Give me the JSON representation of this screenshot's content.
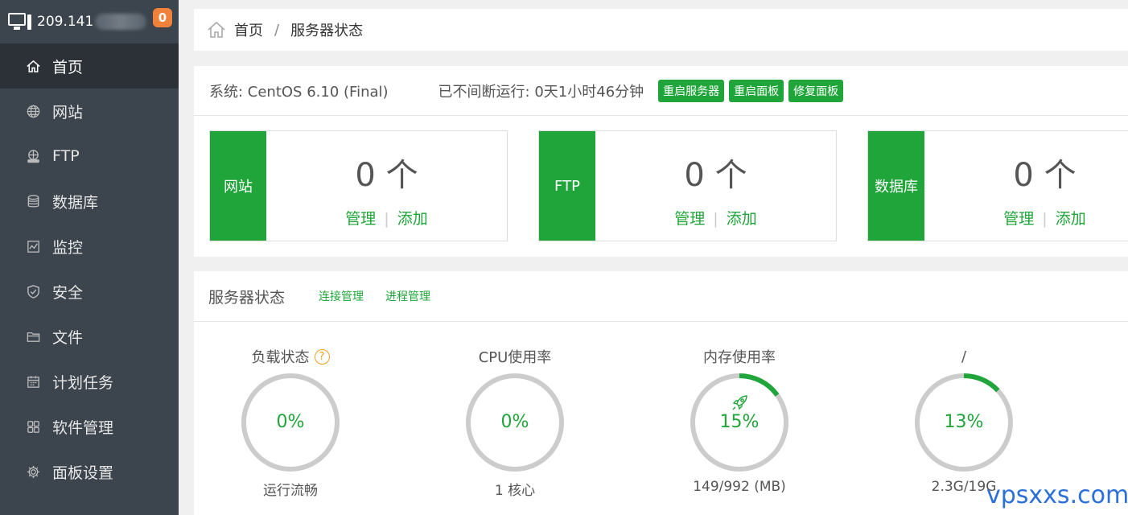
{
  "sidebar": {
    "server_ip": "209.141",
    "notification_count": "0",
    "items": [
      {
        "label": "首页",
        "icon": "home-icon",
        "active": true
      },
      {
        "label": "网站",
        "icon": "globe-icon"
      },
      {
        "label": "FTP",
        "icon": "ftp-icon"
      },
      {
        "label": "数据库",
        "icon": "database-icon"
      },
      {
        "label": "监控",
        "icon": "monitor-chart-icon"
      },
      {
        "label": "安全",
        "icon": "shield-icon"
      },
      {
        "label": "文件",
        "icon": "folder-icon"
      },
      {
        "label": "计划任务",
        "icon": "calendar-icon"
      },
      {
        "label": "软件管理",
        "icon": "grid-icon"
      },
      {
        "label": "面板设置",
        "icon": "gear-icon"
      }
    ]
  },
  "breadcrumb": {
    "home": "首页",
    "separator": "/",
    "current": "服务器状态"
  },
  "system": {
    "os_label": "系统: CentOS 6.10 (Final)",
    "uptime_label": "已不间断运行: 0天1小时46分钟",
    "buttons": [
      "重启服务器",
      "重启面板",
      "修复面板"
    ]
  },
  "cards": [
    {
      "tag": "网站",
      "count": "0 个",
      "manage": "管理",
      "separator": "|",
      "add": "添加"
    },
    {
      "tag": "FTP",
      "count": "0 个",
      "manage": "管理",
      "separator": "|",
      "add": "添加"
    },
    {
      "tag": "数据库",
      "count": "0 个",
      "manage": "管理",
      "separator": "|",
      "add": "添加"
    }
  ],
  "status": {
    "title": "服务器状态",
    "links": [
      "连接管理",
      "进程管理"
    ],
    "gauges": [
      {
        "title": "负载状态",
        "help": "?",
        "percent": 0,
        "label": "0%",
        "sub": "运行流畅"
      },
      {
        "title": "CPU使用率",
        "percent": 0,
        "label": "0%",
        "sub": "1 核心"
      },
      {
        "title": "内存使用率",
        "percent": 15,
        "label": "15%",
        "sub": "149/992 (MB)",
        "icon": "rocket-icon"
      },
      {
        "title": "/",
        "percent": 13,
        "label": "13%",
        "sub": "2.3G/19G"
      }
    ]
  },
  "colors": {
    "accent": "#20a53a",
    "sidebar": "#3c444d",
    "badge": "#f0813a",
    "ring_track": "#cccccc"
  },
  "watermark": "vpsxxs.com"
}
